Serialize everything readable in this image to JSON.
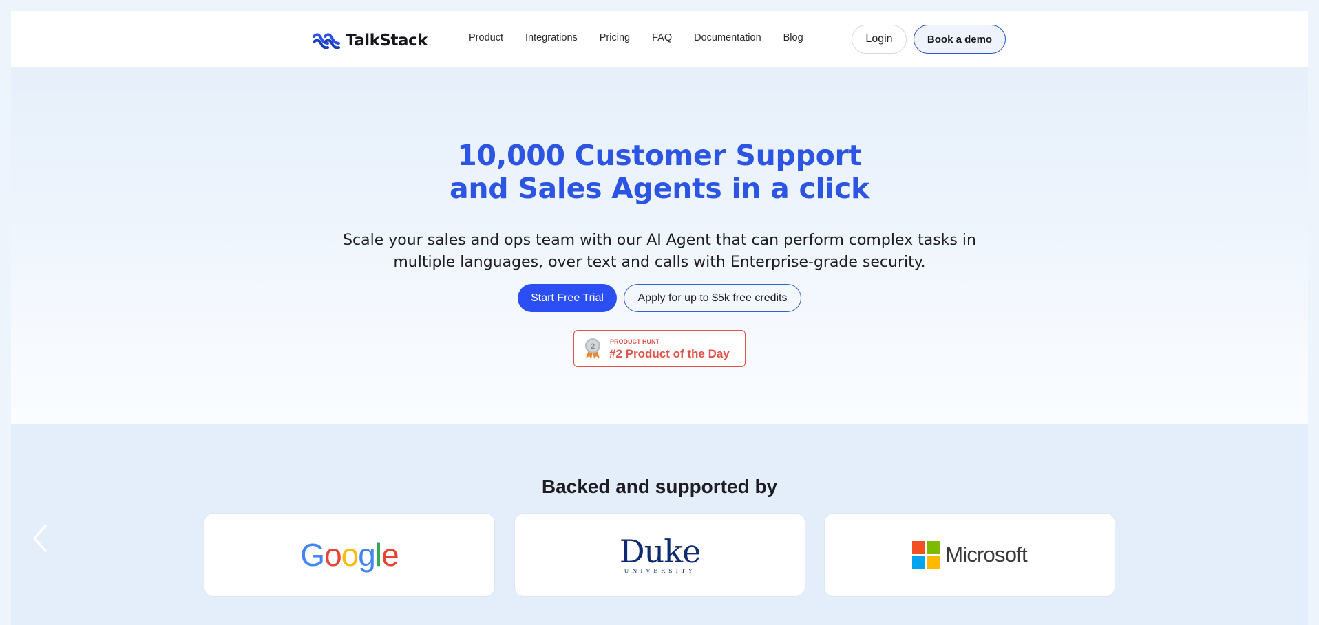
{
  "brand": {
    "name": "TalkStack"
  },
  "nav": {
    "links": [
      "Product",
      "Integrations",
      "Pricing",
      "FAQ",
      "Documentation",
      "Blog"
    ],
    "login_label": "Login",
    "demo_label": "Book a demo"
  },
  "hero": {
    "title_line1": "10,000 Customer Support",
    "title_line2": "and Sales Agents in a click",
    "subtitle_line1": "Scale your sales and ops team with our AI Agent that can perform complex tasks in",
    "subtitle_line2": "multiple languages, over text and calls with Enterprise-grade security.",
    "primary_cta": "Start Free Trial",
    "secondary_cta": "Apply for up to $5k free credits"
  },
  "product_hunt": {
    "eyebrow": "PRODUCT HUNT",
    "title": "#2 Product of the Day",
    "medal_number": "2"
  },
  "backers": {
    "title": "Backed and supported by",
    "logos": [
      {
        "name": "Google",
        "letters": [
          "G",
          "o",
          "o",
          "g",
          "l",
          "e"
        ]
      },
      {
        "name": "Duke",
        "subtitle": "UNIVERSITY"
      },
      {
        "name": "Microsoft"
      }
    ]
  },
  "colors": {
    "accent": "#2b4ff5",
    "hero_title": "#2d55e4",
    "product_hunt": "#e0534a",
    "google_blue": "#4285f4",
    "google_red": "#ea4335",
    "google_yellow": "#fbbc05",
    "google_green": "#34a853",
    "duke_navy": "#0f2a6e",
    "ms_red": "#f25022",
    "ms_green": "#7fba00",
    "ms_blue": "#00a4ef",
    "ms_yellow": "#ffb900"
  },
  "icons": [
    "talkstack-logo-icon",
    "medal-icon",
    "chevron-left-icon",
    "microsoft-logo-icon"
  ]
}
